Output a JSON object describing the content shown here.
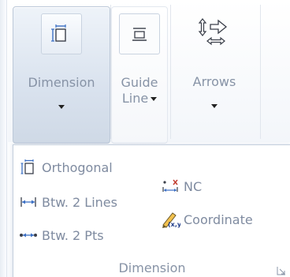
{
  "ribbon": {
    "buttons": [
      {
        "label": "Dimension",
        "icon": "dimension-icon",
        "has_dropdown": true
      },
      {
        "label_line1": "Guide",
        "label_line2": "Line",
        "icon": "guide-line-icon",
        "has_dropdown": true
      },
      {
        "label": "Arrows",
        "icon": "arrows-icon",
        "has_dropdown": true
      }
    ]
  },
  "dropdown": {
    "items": [
      {
        "label": "Orthogonal",
        "icon": "orthogonal-icon"
      },
      {
        "label": "Btw. 2 Lines",
        "icon": "between-lines-icon"
      },
      {
        "label": "Btw. 2 Pts",
        "icon": "between-points-icon"
      },
      {
        "label": "NC",
        "icon": "nc-icon"
      },
      {
        "label": "Coordinate",
        "icon": "coordinate-icon"
      }
    ],
    "group_label": "Dimension",
    "launcher_icon": "dialog-launcher-icon"
  },
  "colors": {
    "text": "#8793a6",
    "accent_blue": "#3b6fc4",
    "active_bg": "#d9e2ee"
  }
}
